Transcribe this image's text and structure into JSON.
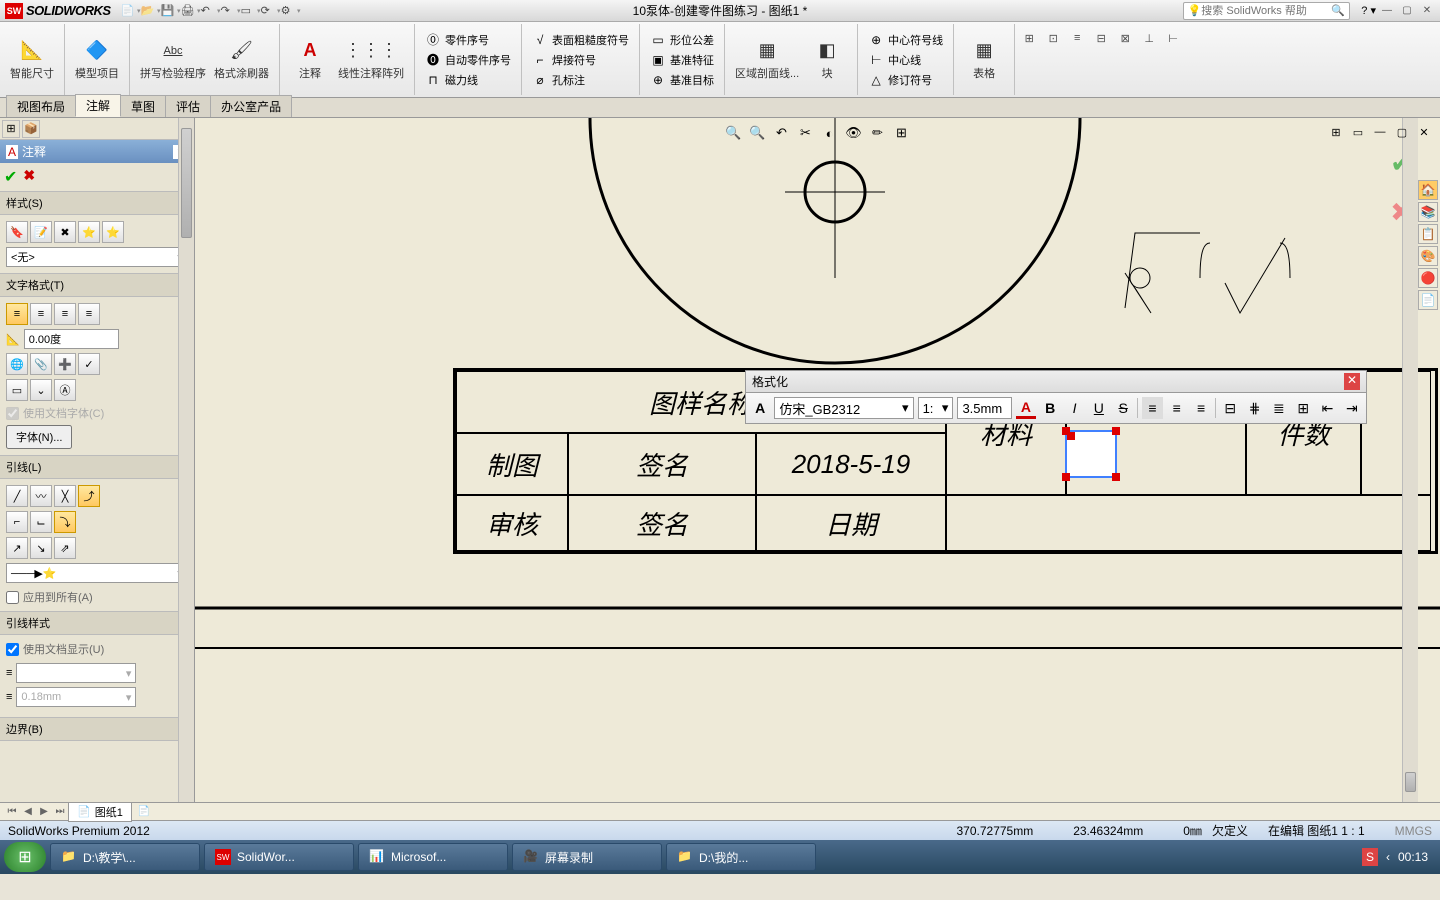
{
  "app": {
    "name": "SOLIDWORKS",
    "doc_title": "10泵体-创建零件图练习 - 图纸1 *",
    "search_placeholder": "搜索 SolidWorks 帮助"
  },
  "ribbon": {
    "big": [
      {
        "label": "智能尺寸",
        "icon": "📐"
      },
      {
        "label": "模型项目",
        "icon": "🔷"
      },
      {
        "label": "拼写检验程序",
        "icon": "Abc"
      },
      {
        "label": "格式涂刷器",
        "icon": "🖌"
      },
      {
        "label": "注释",
        "icon": "A"
      },
      {
        "label": "线性注释阵列",
        "icon": "⋮⋮"
      }
    ],
    "col1": [
      "零件序号",
      "自动零件序号",
      "磁力线"
    ],
    "col2": [
      "表面粗糙度符号",
      "焊接符号",
      "孔标注"
    ],
    "col3": [
      "形位公差",
      "基准特征",
      "基准目标"
    ],
    "big2": [
      {
        "label": "区域剖面线...",
        "icon": "▦"
      },
      {
        "label": "块",
        "icon": "◧"
      }
    ],
    "col4": [
      "中心符号线",
      "中心线",
      "修订符号"
    ],
    "big3": [
      {
        "label": "表格",
        "icon": "▦"
      }
    ]
  },
  "tabs": [
    "视图布局",
    "注解",
    "草图",
    "评估",
    "办公室产品"
  ],
  "active_tab": "注解",
  "panel": {
    "title": "注释",
    "sec_style": "样式(S)",
    "style_combo": "<无>",
    "sec_text": "文字格式(T)",
    "angle_value": "0.00度",
    "use_doc_font": "使用文档字体(C)",
    "font_btn": "字体(N)...",
    "sec_leader": "引线(L)",
    "apply_all": "应用到所有(A)",
    "sec_leader_style": "引线样式",
    "use_doc_display": "使用文档显示(U)",
    "thickness_ph": "0.18mm",
    "sec_border": "边界(B)"
  },
  "format_toolbar": {
    "title": "格式化",
    "font": "仿宋_GB2312",
    "size": "1:",
    "height": "3.5mm"
  },
  "title_block": {
    "name_label": "图样名称",
    "material": "材料",
    "qty": "件数",
    "rows": [
      [
        "制图",
        "签名",
        "2018-5-19"
      ],
      [
        "审核",
        "签名",
        "日期"
      ]
    ]
  },
  "sheet_tab": "图纸1",
  "status": {
    "product": "SolidWorks Premium 2012",
    "x": "370.72775mm",
    "y": "23.46324mm",
    "z": "0㎜",
    "defined": "欠定义",
    "editing": "在编辑 图纸1  1 : 1",
    "units": "MMGS"
  },
  "taskbar": {
    "items": [
      "D:\\教学\\...",
      "SolidWor...",
      "Microsof...",
      "屏幕录制",
      "D:\\我的..."
    ],
    "time": "00:13"
  }
}
